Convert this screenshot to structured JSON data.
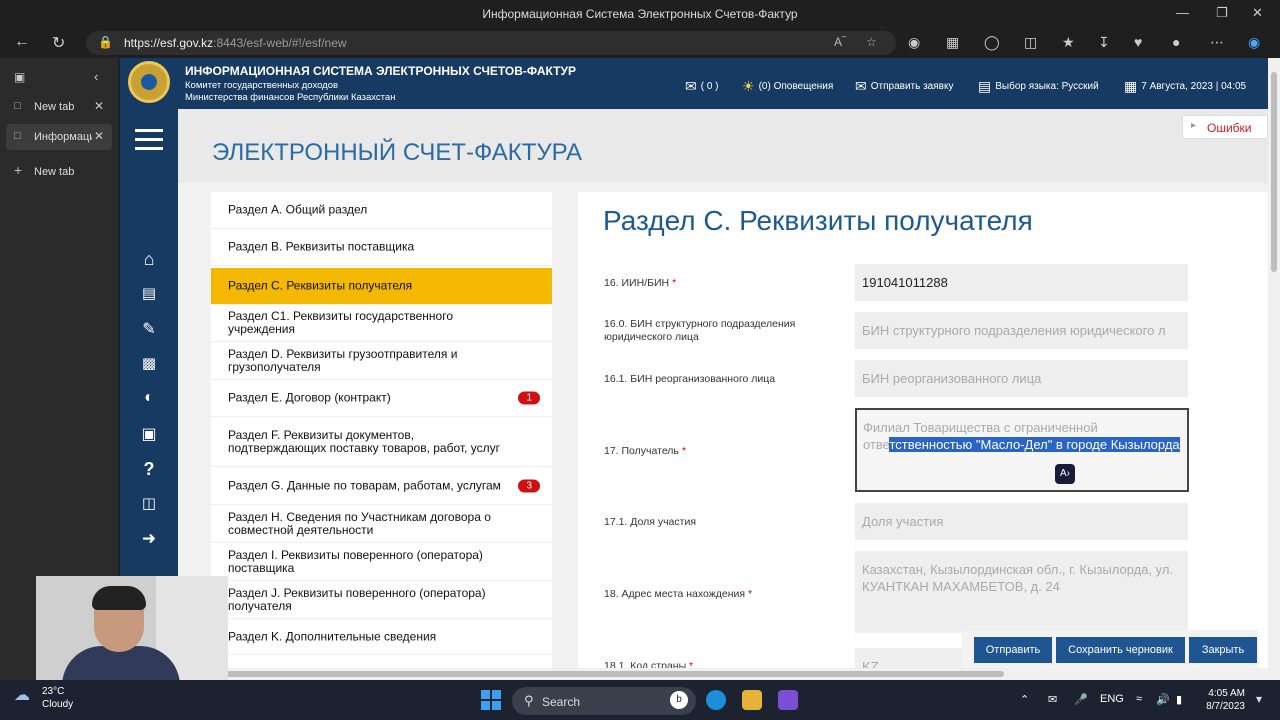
{
  "browser": {
    "window_title": "Информационная Система Электронных Счетов-Фактур",
    "url_host": "https://esf.gov.kz",
    "url_rest": ":8443/esf-web/#!/esf/new",
    "tabs": [
      {
        "label": "New tab"
      },
      {
        "label": "Информационная"
      },
      {
        "label": "New tab"
      }
    ]
  },
  "header": {
    "system_title": "ИНФОРМАЦИОННАЯ СИСТЕМА ЭЛЕКТРОННЫХ СЧЕТОВ-ФАКТУР",
    "org_line1": "Комитет государственных доходов",
    "org_line2": "Министерства финансов Республики Казахстан",
    "mail_count": "( 0 )",
    "notifications": "(0) Оповещения",
    "send_request": "Отправить заявку",
    "language": "Выбор языка: Русский",
    "datetime": "7 Августа, 2023 | 04:05"
  },
  "page_title": "ЭЛЕКТРОННЫЙ СЧЕТ-ФАКТУРА",
  "errors_label": "Ошибки",
  "sections": [
    {
      "label": "Раздел A. Общий раздел"
    },
    {
      "label": "Раздел B. Реквизиты поставщика"
    },
    {
      "label": "Раздел C. Реквизиты получателя"
    },
    {
      "label": "Раздел C1. Реквизиты государственного учреждения"
    },
    {
      "label": "Раздел D. Реквизиты грузоотправителя и грузополучателя"
    },
    {
      "label": "Раздел E. Договор (контракт)",
      "badge": "1"
    },
    {
      "label": "Раздел F. Реквизиты документов, подтверждающих поставку товаров, работ, услуг"
    },
    {
      "label": "Раздел G. Данные по товарам, работам, услугам",
      "badge": "3"
    },
    {
      "label": "Раздел H. Сведения по Участникам договора о совместной деятельности"
    },
    {
      "label": "Раздел I. Реквизиты поверенного (оператора) поставщика"
    },
    {
      "label": "Раздел J. Реквизиты поверенного (оператора) получателя"
    },
    {
      "label": "Раздел K. Дополнительные сведения"
    }
  ],
  "form": {
    "heading": "Раздел C. Реквизиты получателя",
    "fields": [
      {
        "label": "16. ИИН/БИН",
        "value": "191041011288"
      },
      {
        "label": "16.0. БИН структурного подразделения юридического лица",
        "placeholder": "БИН структурного подразделения юридического л"
      },
      {
        "label": "16.1. БИН реорганизованного лица",
        "placeholder": "БИН реорганизованного лица"
      },
      {
        "label": "17. Получатель",
        "value_plain": "Филиал Товарищества с ограниченной отве",
        "value_selected": "тственностью \"Масло-Дел\" в городе Кызылорда"
      },
      {
        "label": "17.1. Доля участия",
        "placeholder": "Доля участия"
      },
      {
        "label": "18. Адрес места нахождения",
        "value": "Казахстан, Кызылординская обл., г. Кызылорда, ул. КУАНТКАН МАХАМБЕТОВ, д. 24"
      },
      {
        "label": "18.1. Код страны",
        "value": "KZ"
      }
    ]
  },
  "actions": {
    "send": "Отправить",
    "save_draft": "Сохранить черновик",
    "close": "Закрыть"
  },
  "taskbar": {
    "temperature": "23°C",
    "weather": "Cloudy",
    "search": "Search",
    "lang": "ENG",
    "time": "4:05 AM",
    "date": "8/7/2023"
  }
}
